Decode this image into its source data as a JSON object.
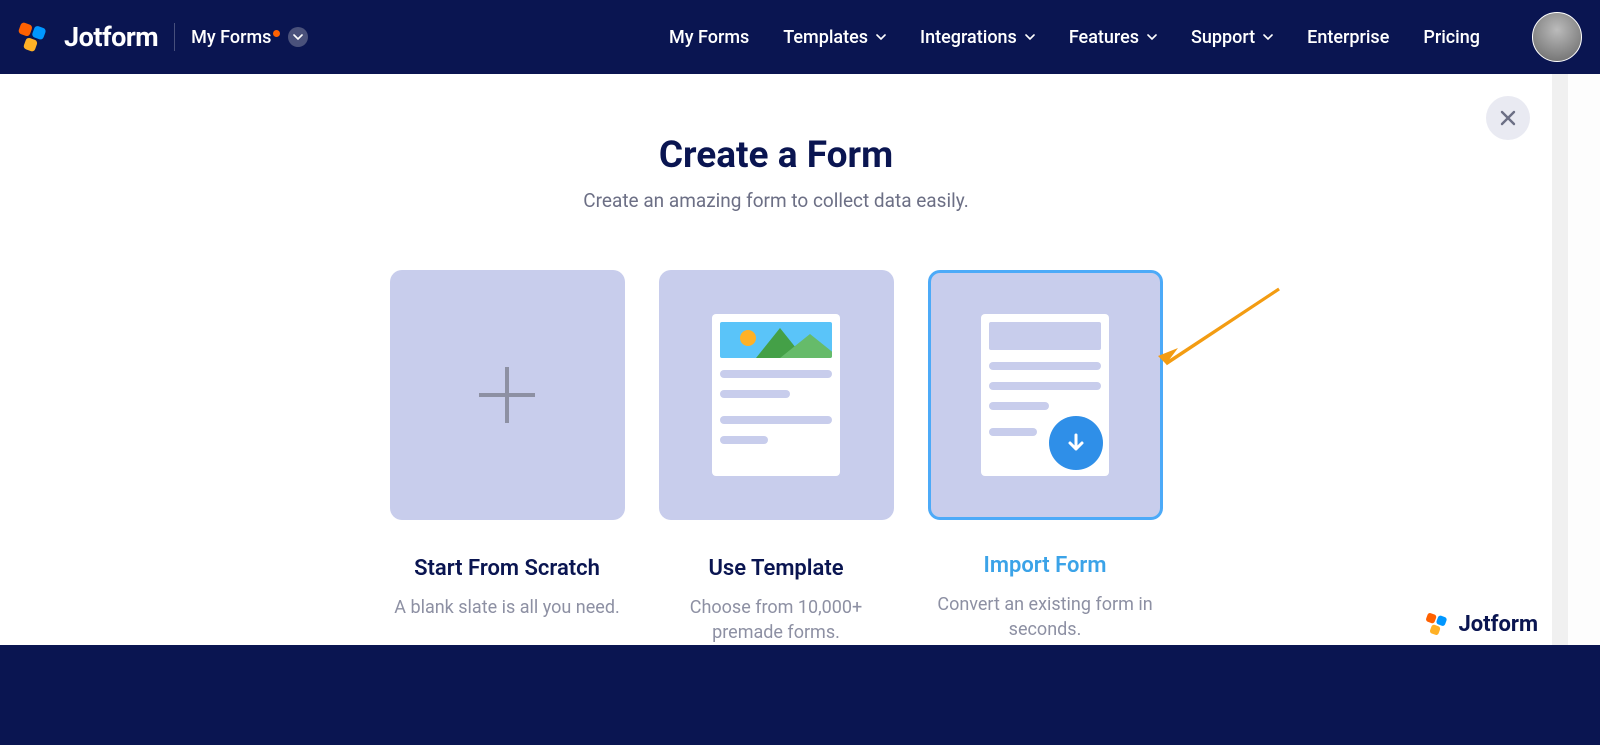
{
  "brand": {
    "name": "Jotform",
    "watermark": "Jotform"
  },
  "header": {
    "context_label": "My Forms",
    "nav": [
      "My Forms",
      "Templates",
      "Integrations",
      "Features",
      "Support",
      "Enterprise",
      "Pricing"
    ],
    "dropdown_flags": [
      false,
      true,
      true,
      true,
      true,
      false,
      false
    ]
  },
  "page": {
    "title": "Create a Form",
    "subtitle": "Create an amazing form to collect data easily."
  },
  "options": [
    {
      "title": "Start From Scratch",
      "desc": "A blank slate is all you need.",
      "selected": false,
      "icon": "plus"
    },
    {
      "title": "Use Template",
      "desc": "Choose from 10,000+ premade forms.",
      "selected": false,
      "icon": "template-doc"
    },
    {
      "title": "Import Form",
      "desc": "Convert an existing form in seconds.",
      "selected": true,
      "icon": "import-doc"
    }
  ],
  "colors": {
    "navy": "#0a1551",
    "tile": "#c8cdec",
    "accent_selected": "#4caaf8",
    "text_muted": "#6c6f85",
    "watermark_text": "#0a1551"
  }
}
